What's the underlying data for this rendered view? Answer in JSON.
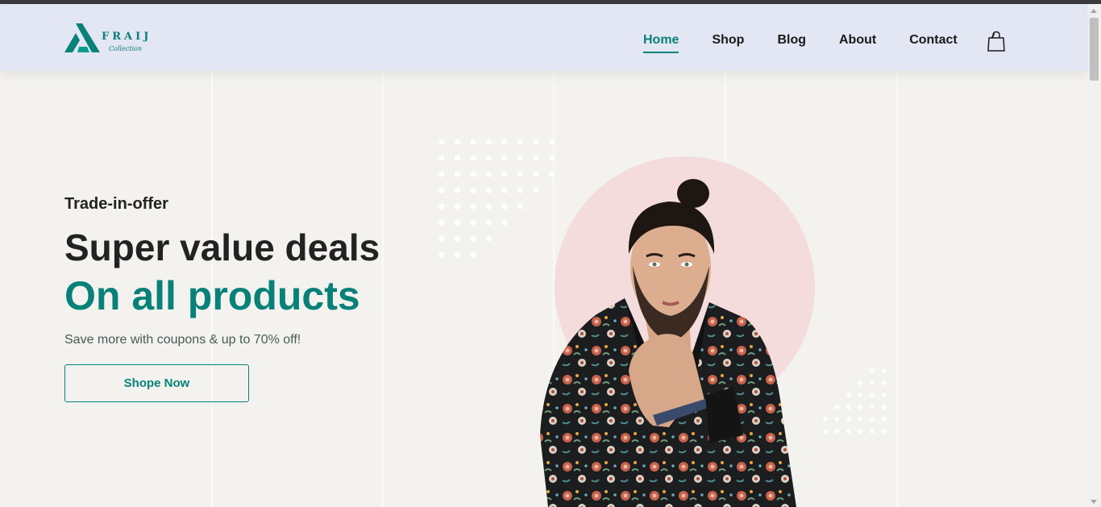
{
  "brand": {
    "name": "FRAIJ",
    "tagline": "Collection",
    "accent_color": "#088178"
  },
  "nav": {
    "items": [
      {
        "label": "Home",
        "active": true
      },
      {
        "label": "Shop",
        "active": false
      },
      {
        "label": "Blog",
        "active": false
      },
      {
        "label": "About",
        "active": false
      },
      {
        "label": "Contact",
        "active": false
      }
    ],
    "cart_icon": "shopping-bag-icon"
  },
  "hero": {
    "tag": "Trade-in-offer",
    "headline": "Super value deals",
    "subheadline": "On all products",
    "text": "Save more with coupons & up to 70% off!",
    "button_label": "Shope Now",
    "image": "man-in-floral-jacket"
  }
}
